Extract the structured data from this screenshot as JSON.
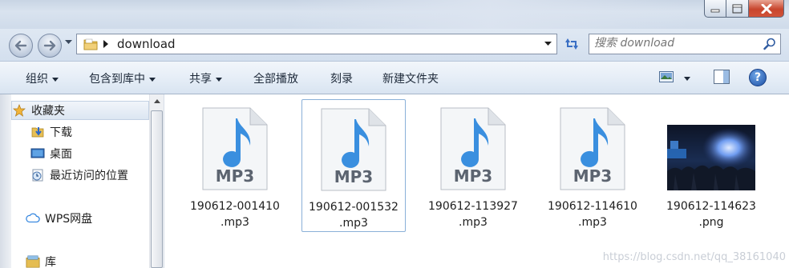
{
  "window": {
    "controls": [
      "minimize",
      "maximize",
      "close"
    ]
  },
  "address": {
    "path": "download"
  },
  "search": {
    "placeholder": "搜索 download"
  },
  "toolbar": {
    "organize": "组织",
    "include_in_library": "包含到库中",
    "share": "共享",
    "play_all": "全部播放",
    "burn": "刻录",
    "new_folder": "新建文件夹",
    "help": "?"
  },
  "sidebar": {
    "items": [
      {
        "label": "收藏夹",
        "icon": "star-icon"
      },
      {
        "label": "下载",
        "icon": "download-folder-icon"
      },
      {
        "label": "桌面",
        "icon": "desktop-icon"
      },
      {
        "label": "最近访问的位置",
        "icon": "recent-places-icon"
      },
      {
        "label": "WPS网盘",
        "icon": "cloud-icon"
      },
      {
        "label": "库",
        "icon": "library-icon"
      }
    ]
  },
  "files": [
    {
      "line1": "190612-001410",
      "line2": ".mp3",
      "type": "mp3",
      "icon_text": "MP3"
    },
    {
      "line1": "190612-001532",
      "line2": ".mp3",
      "type": "mp3",
      "icon_text": "MP3"
    },
    {
      "line1": "190612-113927",
      "line2": ".mp3",
      "type": "mp3",
      "icon_text": "MP3"
    },
    {
      "line1": "190612-114610",
      "line2": ".mp3",
      "type": "mp3",
      "icon_text": "MP3"
    },
    {
      "line1": "190612-114623",
      "line2": ".png",
      "type": "png"
    }
  ],
  "watermark": "https://blog.csdn.net/qq_38161040",
  "colors": {
    "accent": "#3a8fdf",
    "selection_border": "#8ab0d8"
  }
}
